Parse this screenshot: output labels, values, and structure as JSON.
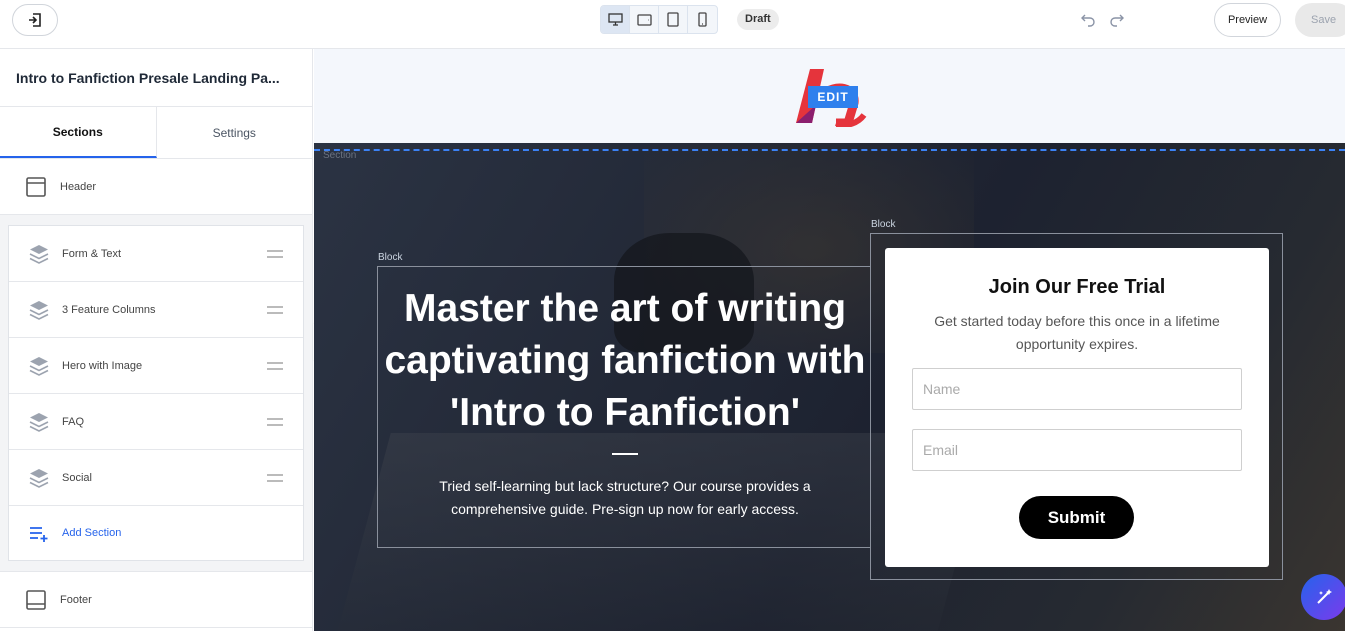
{
  "topbar": {
    "devices": [
      "desktop",
      "tablet-landscape",
      "tablet-portrait",
      "mobile"
    ],
    "draft_label": "Draft",
    "preview_label": "Preview",
    "save_label": "Save"
  },
  "sidebar": {
    "page_title": "Intro to Fanfiction Presale Landing Pa...",
    "tabs": [
      "Sections",
      "Settings"
    ],
    "header_label": "Header",
    "sections": [
      {
        "label": "Form & Text"
      },
      {
        "label": "3 Feature Columns"
      },
      {
        "label": "Hero with Image"
      },
      {
        "label": "FAQ"
      },
      {
        "label": "Social"
      }
    ],
    "add_section_label": "Add Section",
    "footer_label": "Footer"
  },
  "canvas": {
    "edit_label": "EDIT",
    "section_label": "Section",
    "block_label": "Block",
    "headline": "Master the art of writing captivating fanfiction with 'Intro to Fanfiction'",
    "subtext": "Tried self-learning but lack structure? Our course provides a comprehensive guide. Pre-sign up now for early access.",
    "form": {
      "title": "Join Our Free Trial",
      "subtitle": "Get started today before this once in a lifetime opportunity expires.",
      "name_placeholder": "Name",
      "email_placeholder": "Email",
      "submit_label": "Submit"
    }
  },
  "colors": {
    "accent": "#2563eb",
    "edit_tag": "#2f80ed",
    "hero_bg": "#1e2431"
  }
}
